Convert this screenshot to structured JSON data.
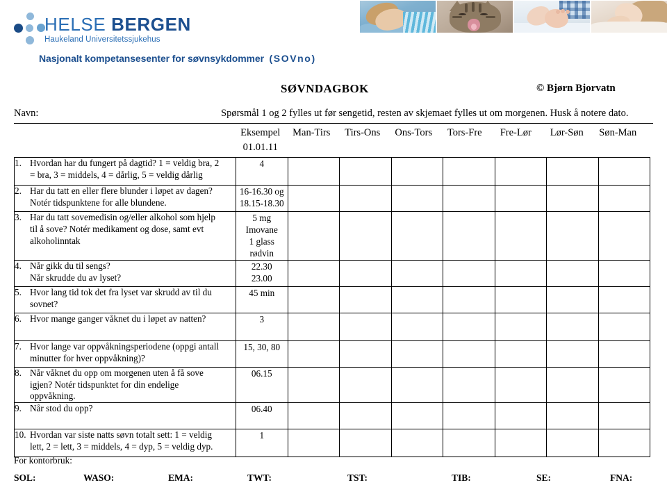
{
  "header": {
    "logo": {
      "org_line1_light": "HELSE ",
      "org_line1_bold": "BERGEN",
      "org_line2": "Haukeland Universitetssjukehus",
      "center_name": "Nasjonalt kompetansesenter for søvnsykdommer",
      "center_acronym": "(SOVno)",
      "brand_color": "#2a6eb5",
      "brand_color_dark": "#1c4f8f"
    },
    "photos": [
      {
        "name": "sleeping-child-photo"
      },
      {
        "name": "yawning-kitten-photo"
      },
      {
        "name": "baby-feet-photo"
      },
      {
        "name": "sleeping-woman-photo"
      }
    ]
  },
  "title": {
    "document_title": "SØVNDAGBOK",
    "copyright": "© Bjørn Bjorvatn"
  },
  "form": {
    "name_label": "Navn:",
    "instruction": "Spørsmål 1 og 2 fylles ut før sengetid, resten av skjemaet fylles ut om morgenen. Husk å notere dato.",
    "columns": [
      "Eksempel",
      "Man-Tirs",
      "Tirs-Ons",
      "Ons-Tors",
      "Tors-Fre",
      "Fre-Lør",
      "Lør-Søn",
      "Søn-Man"
    ],
    "example_date": "01.01.11"
  },
  "questions": [
    {
      "number": "1.",
      "text": "Hvordan har du fungert på dagtid? 1 = veldig bra, 2 = bra, 3 = middels, 4 = dårlig, 5 = veldig dårlig",
      "example": "4"
    },
    {
      "number": "2.",
      "text": "Har du tatt en eller flere blunder i løpet av dagen? Notér tidspunktene for alle blundene.",
      "example": "16-16.30 og\n18.15-18.30"
    },
    {
      "number": "3.",
      "text": "Har du tatt sovemedisin og/eller alkohol som hjelp til å sove? Notér medikament og dose, samt evt alkoholinntak",
      "example": "5 mg Imovane\n1 glass rødvin"
    },
    {
      "number": "4.",
      "text": "Når gikk du til sengs?\nNår skrudde du av lyset?",
      "example": "22.30\n23.00"
    },
    {
      "number": "5.",
      "text": "Hvor lang tid tok det fra lyset var skrudd av til du sovnet?",
      "example": "45 min"
    },
    {
      "number": "6.",
      "text": "Hvor mange ganger våknet du i løpet av natten?",
      "example": "3"
    },
    {
      "number": "7.",
      "text": "Hvor lange var oppvåkningsperiodene (oppgi antall minutter for hver oppvåkning)?",
      "example": "15, 30, 80"
    },
    {
      "number": "8.",
      "text": "Når våknet du opp om morgenen uten å få sove igjen? Notér tidspunktet for din endelige oppvåkning.",
      "example": "06.15"
    },
    {
      "number": "9.",
      "text": "Når stod du opp?",
      "example": "06.40"
    },
    {
      "number": "10.",
      "text": "Hvordan var siste natts søvn totalt sett: 1 = veldig lett,  2 = lett, 3 = middels, 4 = dyp, 5 = veldig dyp.",
      "example": "1"
    }
  ],
  "footer": {
    "office_use_label": "For kontorbruk:",
    "abbreviations": [
      "SOL:",
      "WASO:",
      "EMA:",
      "TWT:",
      "TST:",
      "TIB:",
      "SE:",
      "FNA:"
    ]
  }
}
